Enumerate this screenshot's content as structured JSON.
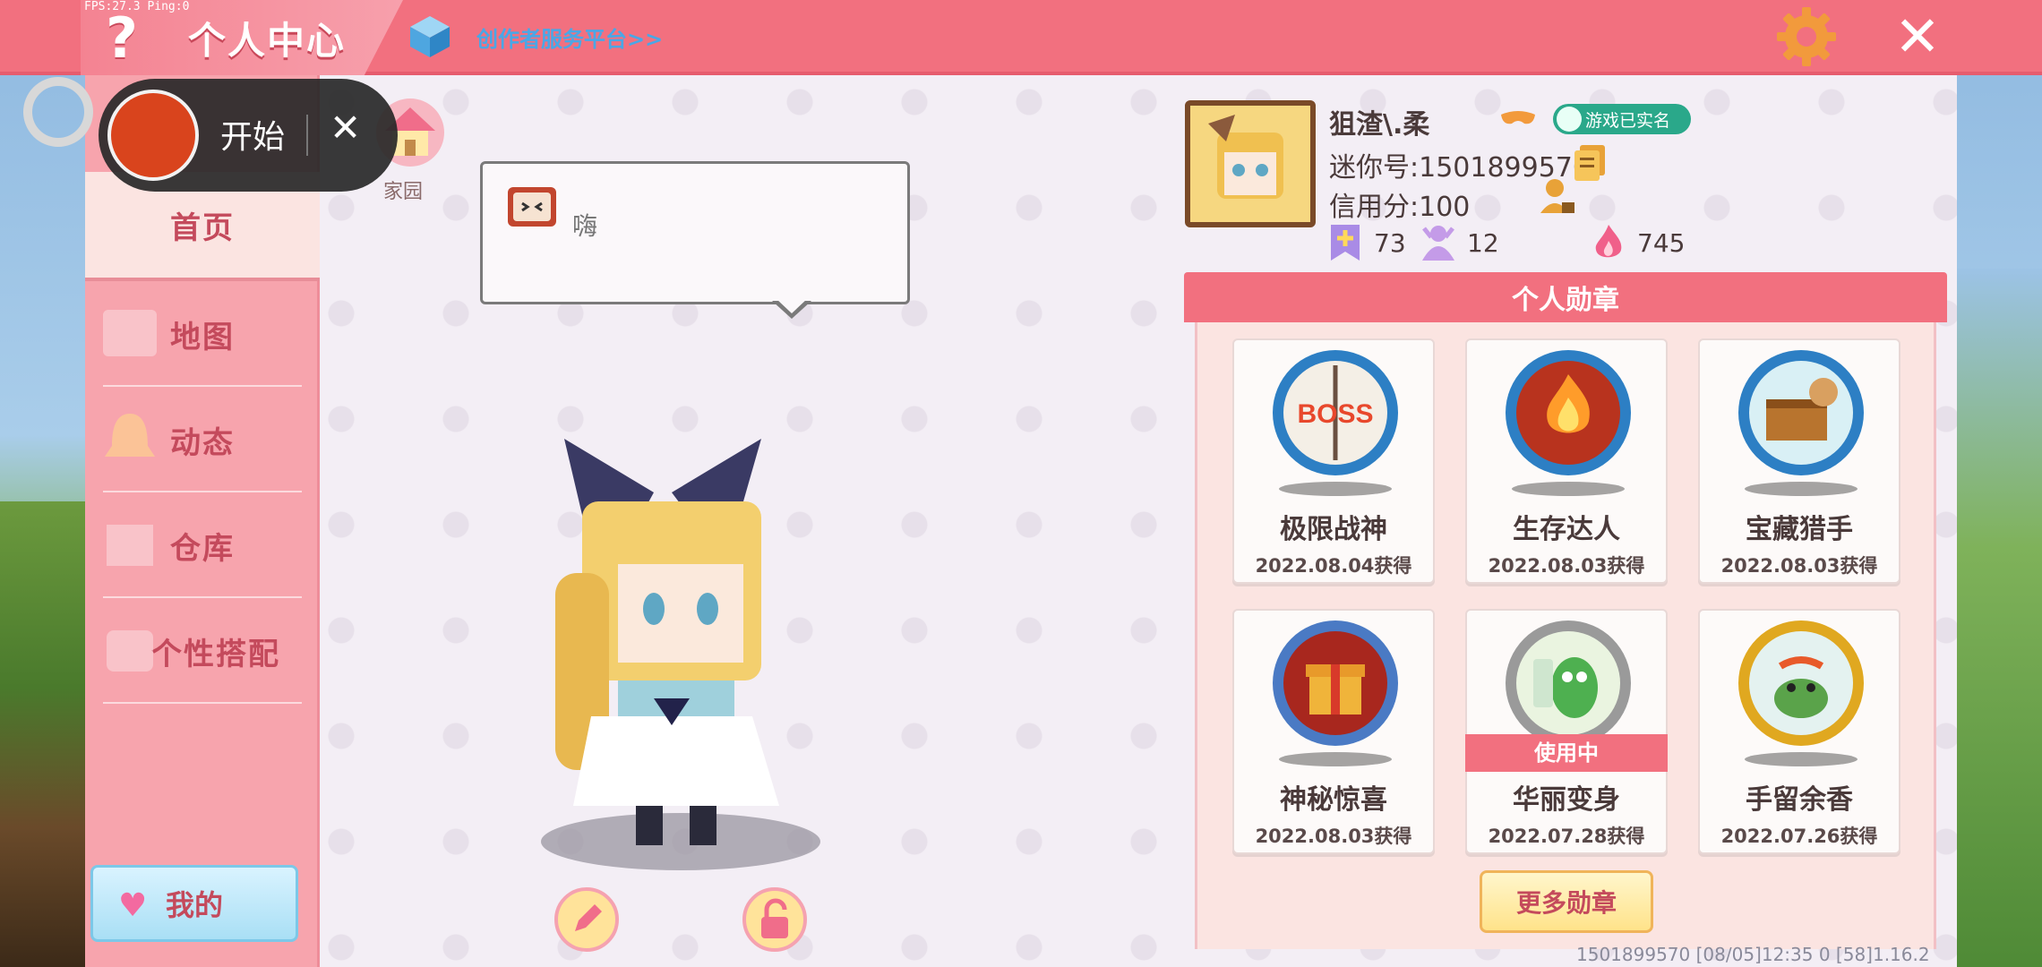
{
  "top": {
    "fps": "FPS:27.3  Ping:0",
    "title": "个人中心",
    "creator_link": "创作者服务平台>>"
  },
  "record": {
    "start_label": "开始"
  },
  "sidebar": {
    "items": [
      {
        "label": "首页"
      },
      {
        "label": "地图"
      },
      {
        "label": "动态"
      },
      {
        "label": "仓库"
      },
      {
        "label": "个性搭配"
      }
    ],
    "my_button": "我的"
  },
  "home": {
    "label": "家园"
  },
  "bubble": {
    "text": "嗨"
  },
  "profile": {
    "name": "狙渣\\.柔",
    "verified": "游戏已实名",
    "uid": "迷你号:1501899570",
    "credit": "信用分:100",
    "stats": [
      {
        "icon": "bookmark-plus-icon",
        "value": "73"
      },
      {
        "icon": "fans-icon",
        "value": "12"
      },
      {
        "icon": "flame-icon",
        "value": "745"
      }
    ]
  },
  "medals": {
    "header": "个人勋章",
    "in_use_label": "使用中",
    "items": [
      {
        "name": "极限战神",
        "date": "2022.08.04获得",
        "icon": "boss-medal-icon"
      },
      {
        "name": "生存达人",
        "date": "2022.08.03获得",
        "icon": "campfire-medal-icon"
      },
      {
        "name": "宝藏猎手",
        "date": "2022.08.03获得",
        "icon": "treasure-medal-icon"
      },
      {
        "name": "神秘惊喜",
        "date": "2022.08.03获得",
        "icon": "gift-medal-icon"
      },
      {
        "name": "华丽变身",
        "date": "2022.07.28获得",
        "icon": "dragon-medal-icon"
      },
      {
        "name": "手留余香",
        "date": "2022.07.26获得",
        "icon": "frog-medal-icon"
      }
    ],
    "more_button": "更多勋章"
  },
  "footer": {
    "info": "1501899570    [08/05]12:35 0   [58]1.16.2"
  },
  "colors": {
    "accent": "#f2707f",
    "sidebar": "#f7a4ad",
    "panel": "#f3eef5"
  }
}
